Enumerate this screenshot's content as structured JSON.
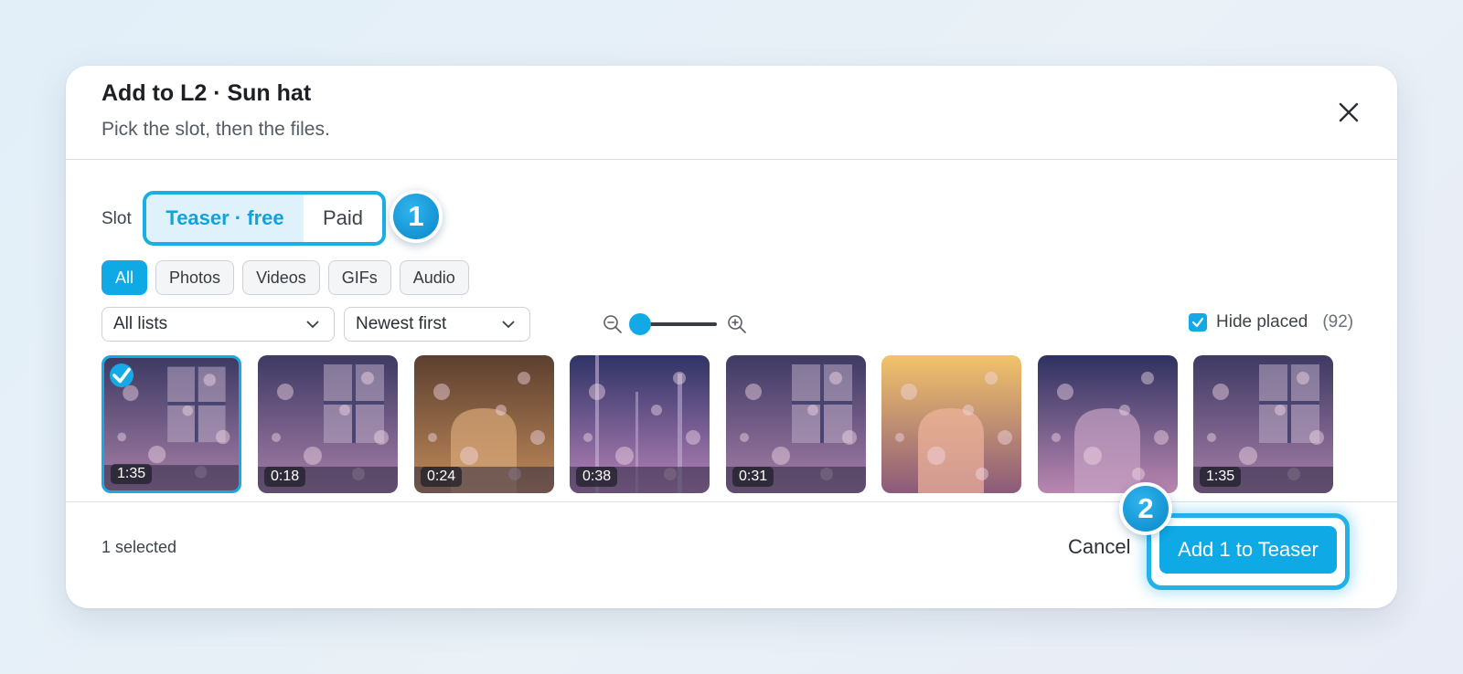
{
  "dialog": {
    "title": "Add to L2 · Sun hat",
    "subtitle": "Pick the slot, then the files."
  },
  "slot": {
    "label": "Slot",
    "options": [
      "Teaser · free",
      "Paid"
    ],
    "selected": "Teaser · free"
  },
  "steps": {
    "one": "1",
    "two": "2"
  },
  "filters": {
    "chips": [
      "All",
      "Photos",
      "Videos",
      "GIFs",
      "Audio"
    ],
    "active": "All"
  },
  "controls": {
    "list_select": "All lists",
    "sort_select": "Newest first",
    "zoom_level": 0,
    "hide_placed_label": "Hide placed",
    "hide_placed_checked": true,
    "hide_placed_count": "(92)"
  },
  "media": [
    {
      "duration": "1:35",
      "selected": true,
      "scene": "window"
    },
    {
      "duration": "0:18",
      "selected": false,
      "scene": "window"
    },
    {
      "duration": "0:24",
      "selected": false,
      "scene": "arch-amber"
    },
    {
      "duration": "0:38",
      "selected": false,
      "scene": "lights"
    },
    {
      "duration": "0:31",
      "selected": false,
      "scene": "window"
    },
    {
      "duration": "",
      "selected": false,
      "scene": "arch-sunset"
    },
    {
      "duration": "",
      "selected": false,
      "scene": "arch-dusk"
    },
    {
      "duration": "1:35",
      "selected": false,
      "scene": "window"
    }
  ],
  "footer": {
    "selected_text": "1 selected",
    "cancel_label": "Cancel",
    "confirm_label": "Add 1 to Teaser"
  },
  "colors": {
    "accent": "#0fa9e6",
    "accent_light": "#dff2fb"
  }
}
